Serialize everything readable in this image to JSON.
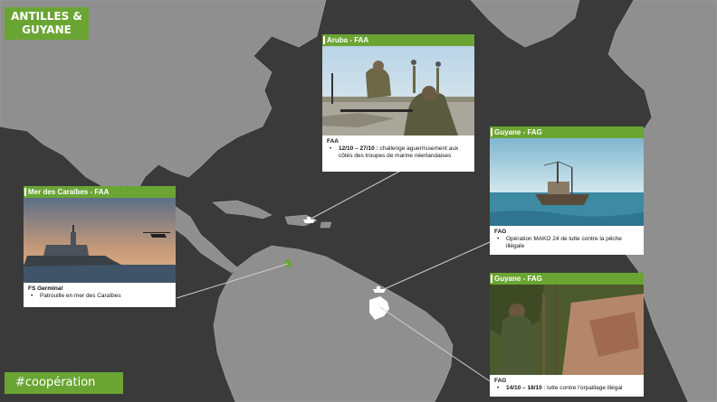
{
  "title": "ANTILLES &\nGUYANE",
  "title_line1": "ANTILLES &",
  "title_line2": "GUYANE",
  "hashtag": "#coopération",
  "colors": {
    "accent": "#6aa534",
    "ocean": "#3a3a3a",
    "land": "#8f8f8f"
  },
  "cards": {
    "aruba": {
      "header": "Aruba - FAA",
      "unit": "FAA",
      "date": "12/10 – 27/10 :",
      "text": " challenge aguerrissement aux côtés des troupes de marine néerlandaises"
    },
    "caraibes": {
      "header": "Mer des Caraïbes - FAA",
      "unit_prefix": "FS ",
      "unit_name": "Germinal",
      "text": "Patrouille en mer des Caraïbes"
    },
    "guyane1": {
      "header": "Guyane - FAG",
      "unit": "FAG",
      "text": "Opération MAKO 24 de lutte contre la pêche illégale"
    },
    "guyane2": {
      "header": "Guyane - FAG",
      "unit": "FAG",
      "date": "14/10 – 18/10",
      "text": " : lutte contre l'orpaillage illégal"
    }
  },
  "map_icons": [
    "ship-icon",
    "ship-icon",
    "ship-icon",
    "soldier-icon"
  ]
}
